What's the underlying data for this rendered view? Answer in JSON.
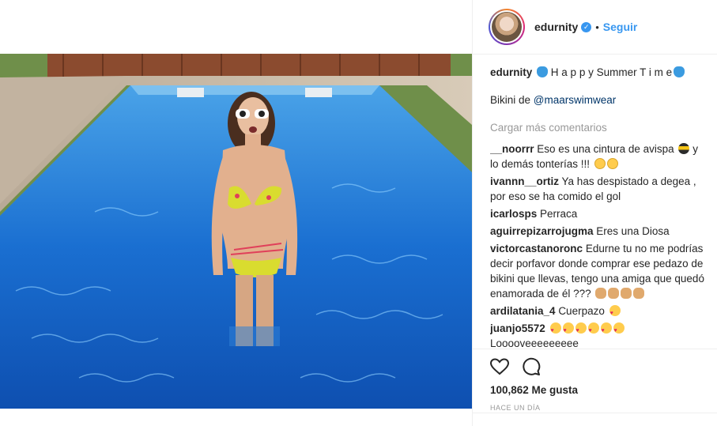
{
  "post": {
    "username": "edurnity",
    "verified_mark": "✓",
    "separator": "•",
    "follow_label": "Seguir",
    "caption_user": "edurnity",
    "caption_text": "H a p p y Summer T i m e",
    "caption_line2_prefix": "Bikini de ",
    "caption_mention": "@maarswimwear",
    "load_more": "Cargar más comentarios",
    "likes": "100,862 Me gusta",
    "time": "HACE UN DÍA"
  },
  "comments": [
    {
      "user": "__noorrr",
      "text": "Eso es una cintura de avispa",
      "text2": "y lo demás tonterías !!!"
    },
    {
      "user": "ivannn__ortiz",
      "text": "Ya has despistado a degea , por eso se ha comido el gol"
    },
    {
      "user": "icarlosps",
      "text": "Perraca"
    },
    {
      "user": "aguirrepizarrojugma",
      "text": "Eres una Diosa"
    },
    {
      "user": "victorcastanoronc",
      "text": "Edurne tu no me podrías decir porfavor donde comprar ese pedazo de bikini que llevas, tengo una amiga que quedó enamorada de él ???"
    },
    {
      "user": "ardilatania_4",
      "text": "Cuerpazo"
    },
    {
      "user": "juanjo5572",
      "text": "",
      "text2": "Looooveeeeeeeee"
    }
  ],
  "icons": {
    "avatar": "avatar",
    "verified": "verified-badge-icon",
    "like": "heart-icon",
    "comment": "comment-bubble-icon"
  },
  "colors": {
    "link": "#3897f0",
    "mention": "#003569",
    "muted": "#999999",
    "pool": "#1a6fd1"
  }
}
